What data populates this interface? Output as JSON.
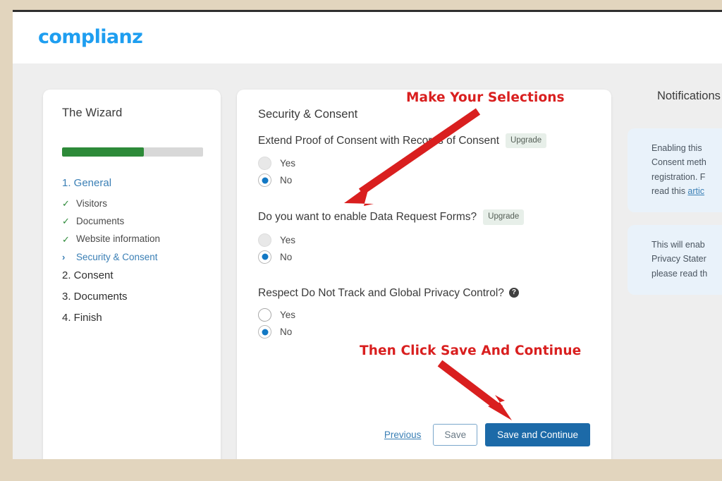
{
  "header": {
    "brand": "complianz"
  },
  "wizard": {
    "title": "The Wizard",
    "progress_percent": 58,
    "progress_color": "#2d8a39",
    "steps": [
      {
        "label": "1. General",
        "active": true
      },
      {
        "label": "2. Consent",
        "active": false
      },
      {
        "label": "3. Documents",
        "active": false
      },
      {
        "label": "4. Finish",
        "active": false
      }
    ],
    "substeps": [
      {
        "label": "Visitors",
        "mark": "✓",
        "state": "done"
      },
      {
        "label": "Documents",
        "mark": "✓",
        "state": "done"
      },
      {
        "label": "Website information",
        "mark": "✓",
        "state": "done"
      },
      {
        "label": "Security & Consent",
        "mark": "›",
        "state": "current"
      }
    ]
  },
  "form": {
    "title": "Security & Consent",
    "fields": [
      {
        "label": "Extend Proof of Consent with Records of Consent",
        "badge": "Upgrade",
        "has_help": false,
        "options": [
          {
            "label": "Yes",
            "selected": false,
            "disabled": true
          },
          {
            "label": "No",
            "selected": true,
            "disabled": false
          }
        ]
      },
      {
        "label": "Do you want to enable Data Request Forms?",
        "badge": "Upgrade",
        "has_help": false,
        "options": [
          {
            "label": "Yes",
            "selected": false,
            "disabled": true
          },
          {
            "label": "No",
            "selected": true,
            "disabled": false
          }
        ]
      },
      {
        "label": "Respect Do Not Track and Global Privacy Control?",
        "badge": "",
        "has_help": true,
        "help_glyph": "?",
        "options": [
          {
            "label": "Yes",
            "selected": false,
            "disabled": false
          },
          {
            "label": "No",
            "selected": true,
            "disabled": false
          }
        ]
      }
    ],
    "footer": {
      "previous_label": "Previous",
      "save_label": "Save",
      "save_continue_label": "Save and Continue",
      "primary_color": "#1c6aa8"
    }
  },
  "notifications": {
    "title": "Notifications",
    "cards": [
      {
        "text": "Enabling this ",
        "line2": "Consent meth",
        "line3": "registration. F",
        "line4_prefix": "read this ",
        "link": "artic"
      },
      {
        "text": "This will enab",
        "line2": "Privacy Stater",
        "line3": "please read th"
      }
    ]
  },
  "annotations": {
    "color": "#d91f1f",
    "top_note": "Make Your Selections",
    "bottom_note": "Then Click Save And Continue"
  }
}
